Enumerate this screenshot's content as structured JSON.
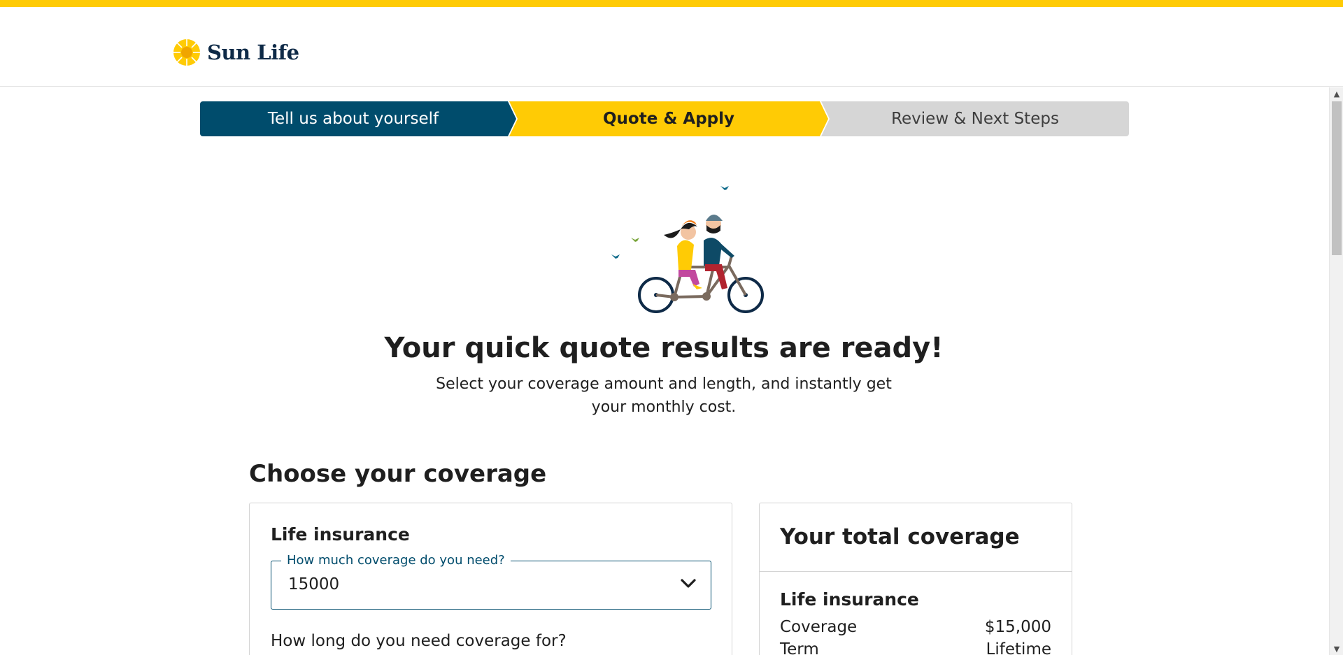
{
  "brand": {
    "name": "Sun Life",
    "accent": "#ffcb05",
    "primary": "#004c6c"
  },
  "stepper": {
    "steps": [
      {
        "label": "Tell us about yourself",
        "state": "complete"
      },
      {
        "label": "Quote & Apply",
        "state": "current"
      },
      {
        "label": "Review & Next Steps",
        "state": "upcoming"
      }
    ]
  },
  "hero": {
    "headline": "Your quick quote results are ready!",
    "subtext": "Select your coverage amount and length, and instantly get your monthly cost."
  },
  "coverage": {
    "section_title": "Choose your coverage",
    "life_insurance": {
      "heading": "Life insurance",
      "amount_field": {
        "label": "How much coverage do you need?",
        "value": "15000"
      },
      "length_question": "How long do you need coverage for?"
    }
  },
  "summary": {
    "heading": "Your total coverage",
    "section": "Life insurance",
    "rows": [
      {
        "label": "Coverage",
        "value": "$15,000"
      },
      {
        "label": "Term",
        "value": "Lifetime"
      }
    ]
  }
}
